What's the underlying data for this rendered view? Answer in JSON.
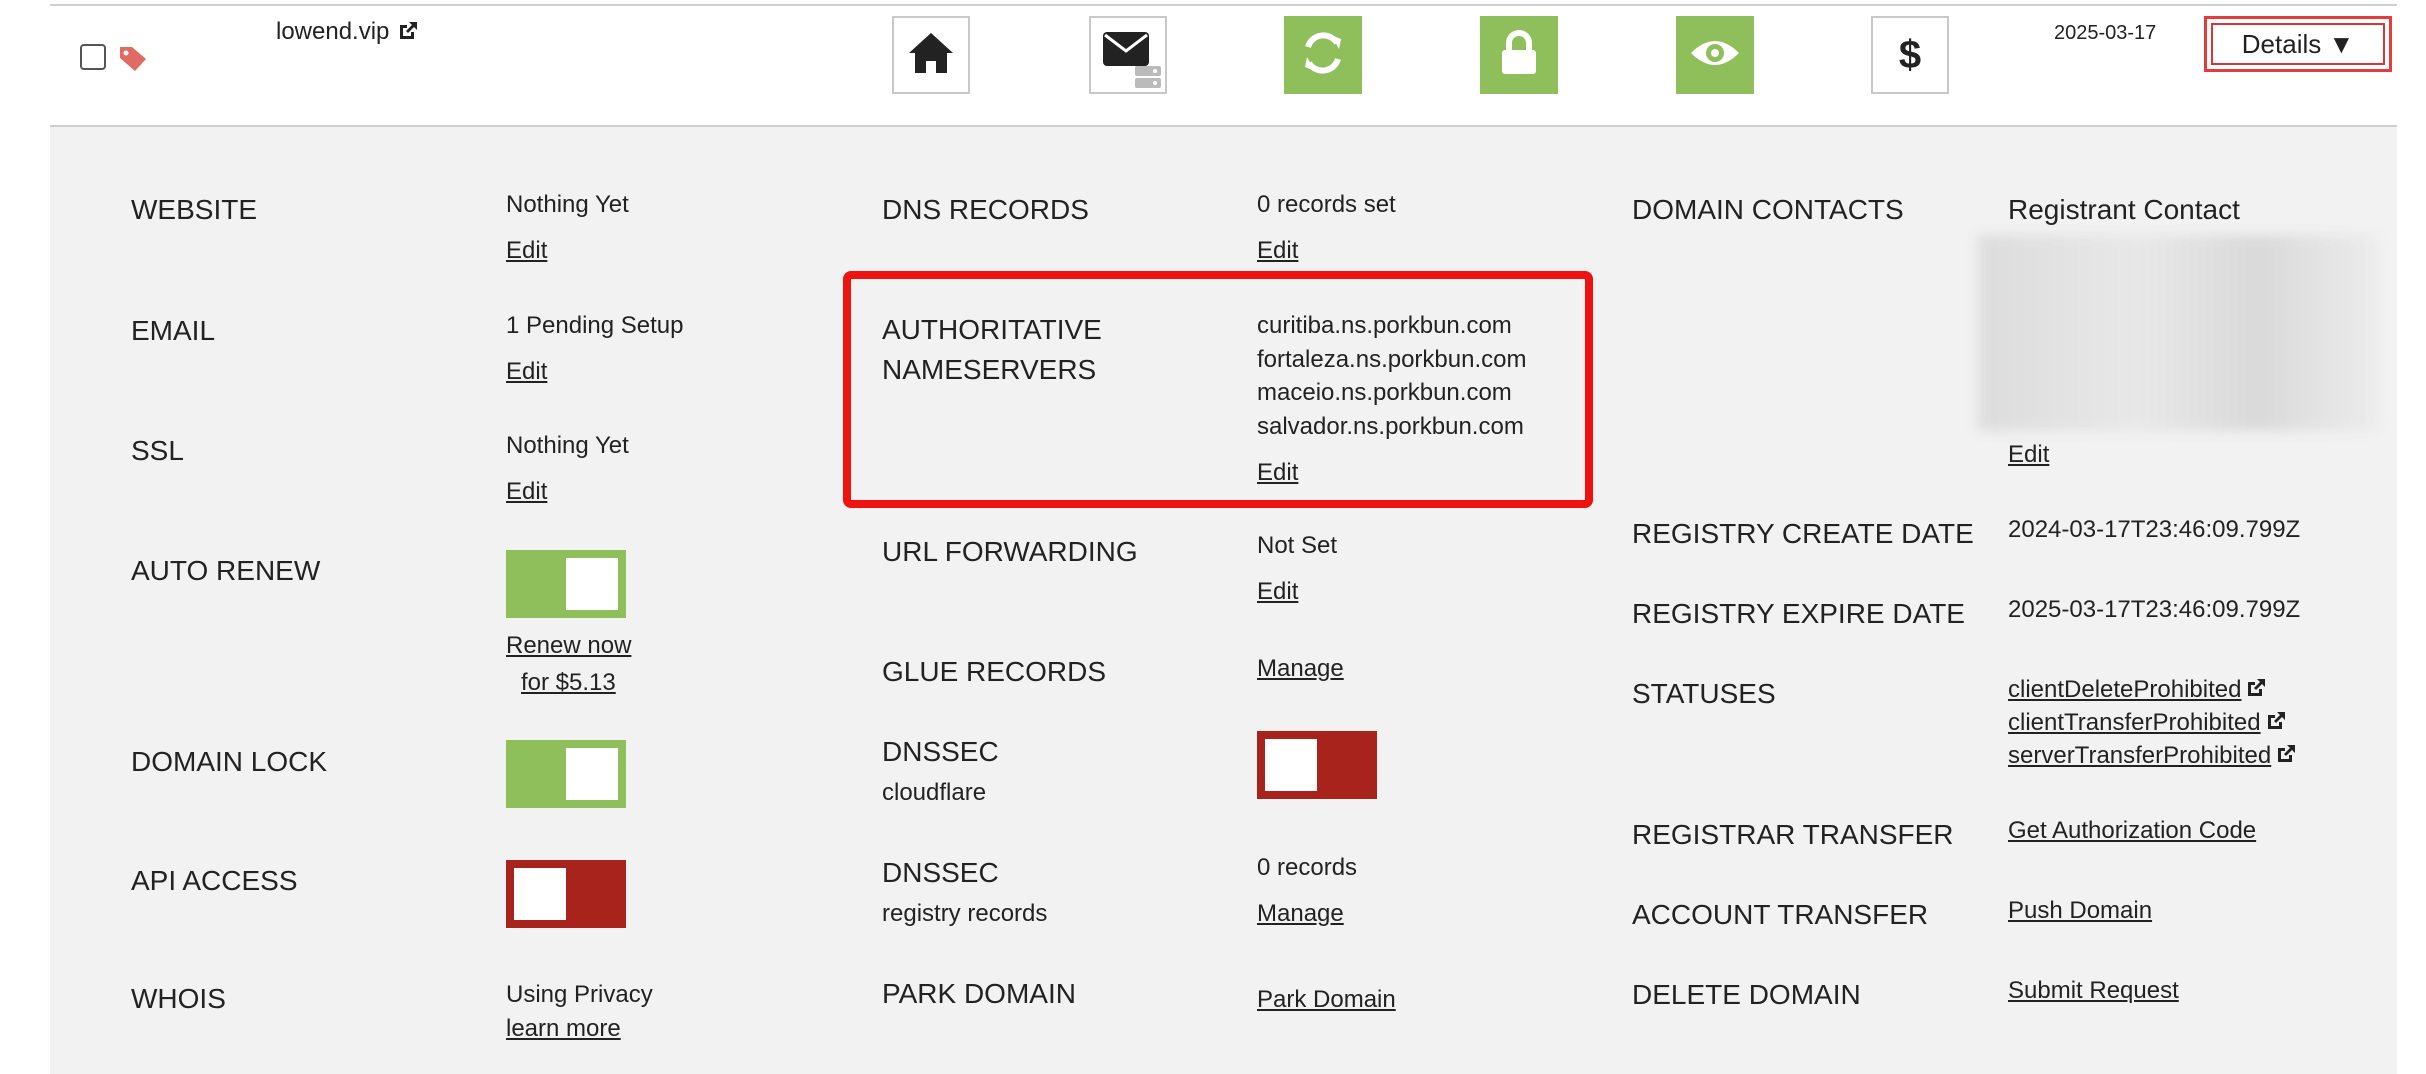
{
  "row": {
    "domain_name": "lowend.vip",
    "date": "2025-03-17",
    "details_label": "Details ▼"
  },
  "colors": {
    "green": "#8fbf5a",
    "red": "#a8231c",
    "highlight": "#f01111",
    "panel": "#f2f2f2"
  },
  "panel": {
    "col1": {
      "website": {
        "label": "WEBSITE",
        "value": "Nothing Yet",
        "link": "Edit"
      },
      "email": {
        "label": "EMAIL",
        "value": "1 Pending Setup",
        "link": "Edit"
      },
      "ssl": {
        "label": "SSL",
        "value": "Nothing Yet",
        "link": "Edit"
      },
      "auto_renew": {
        "label": "AUTO RENEW",
        "state": "on",
        "link_line1": "Renew now",
        "link_line2": "for $5.13"
      },
      "domain_lock": {
        "label": "DOMAIN LOCK",
        "state": "on"
      },
      "api_access": {
        "label": "API ACCESS",
        "state": "off"
      },
      "whois": {
        "label": "WHOIS",
        "value": "Using Privacy",
        "link": "learn more"
      }
    },
    "col2": {
      "dns_records": {
        "label": "DNS RECORDS",
        "value": "0 records set",
        "link": "Edit"
      },
      "nameservers": {
        "label_line1": "AUTHORITATIVE",
        "label_line2": "NAMESERVERS",
        "servers": [
          "curitiba.ns.porkbun.com",
          "fortaleza.ns.porkbun.com",
          "maceio.ns.porkbun.com",
          "salvador.ns.porkbun.com"
        ],
        "link": "Edit"
      },
      "url_forwarding": {
        "label": "URL FORWARDING",
        "value": "Not Set",
        "link": "Edit"
      },
      "glue_records": {
        "label": "GLUE RECORDS",
        "link": "Manage"
      },
      "dnssec_cf": {
        "label": "DNSSEC",
        "sublabel": "cloudflare",
        "state": "off"
      },
      "dnssec_reg": {
        "label": "DNSSEC",
        "sublabel": "registry records",
        "value": "0 records",
        "link": "Manage"
      },
      "park_domain": {
        "label": "PARK DOMAIN",
        "link": "Park Domain"
      }
    },
    "col3": {
      "contacts": {
        "label": "DOMAIN CONTACTS",
        "value": "Registrant Contact",
        "link": "Edit"
      },
      "create_date": {
        "label": "REGISTRY CREATE DATE",
        "value": "2024-03-17T23:46:09.799Z"
      },
      "expire_date": {
        "label": "REGISTRY EXPIRE DATE",
        "value": "2025-03-17T23:46:09.799Z"
      },
      "statuses": {
        "label": "STATUSES",
        "items": [
          "clientDeleteProhibited",
          "clientTransferProhibited",
          "serverTransferProhibited"
        ]
      },
      "registrar_transfer": {
        "label": "REGISTRAR TRANSFER",
        "link": "Get Authorization Code"
      },
      "account_transfer": {
        "label": "ACCOUNT TRANSFER",
        "link": "Push Domain"
      },
      "delete_domain": {
        "label": "DELETE DOMAIN",
        "link": "Submit Request"
      }
    }
  },
  "icons": [
    "tag-icon",
    "external-link-icon",
    "home-icon",
    "mail-icon",
    "refresh-icon",
    "lock-icon",
    "eye-icon",
    "dollar-icon"
  ]
}
